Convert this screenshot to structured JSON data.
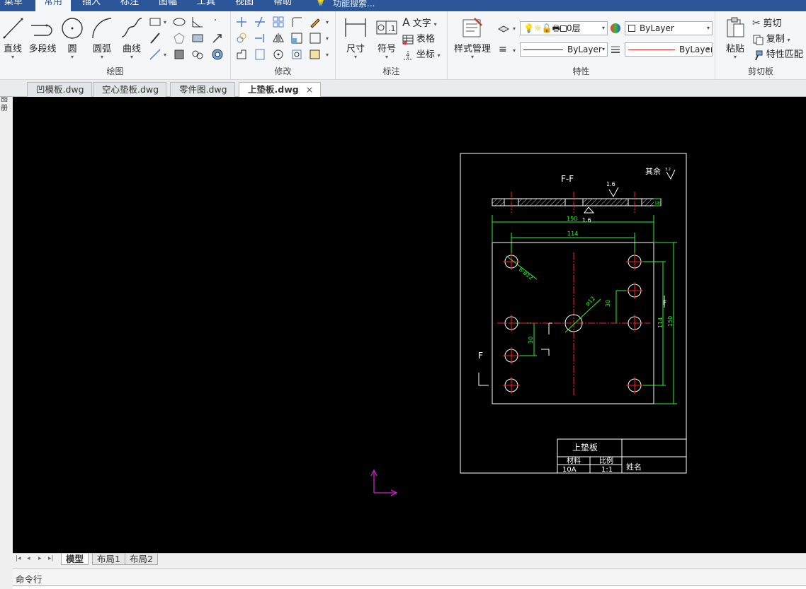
{
  "menu": {
    "tabs": [
      "菜单",
      "常用",
      "插入",
      "标注",
      "图幅",
      "工具",
      "视图",
      "帮助"
    ],
    "active_index": 1,
    "search_placeholder": "功能搜索..."
  },
  "ribbon": {
    "draw": {
      "label": "绘图",
      "line": "直线",
      "polyline": "多段线",
      "circle": "圆",
      "arc": "圆弧",
      "curve": "曲线"
    },
    "modify": {
      "label": "修改"
    },
    "annotate": {
      "label": "标注",
      "dimension": "尺寸",
      "symbol": "符号",
      "text": "文字",
      "table": "表格",
      "coordinate": "坐标"
    },
    "properties": {
      "label": "特性",
      "style_manager": "样式管理",
      "layer_value": "0层",
      "color_value": "ByLayer",
      "linetype_value": "ByLayer",
      "lineweight_value": "ByLayer"
    },
    "clipboard": {
      "label": "剪切板",
      "paste": "粘贴",
      "cut": "剪切",
      "copy": "复制",
      "match_props": "特性匹配"
    }
  },
  "doc_tabs": [
    {
      "label": "凹模板.dwg"
    },
    {
      "label": "空心垫板.dwg"
    },
    {
      "label": "零件图.dwg"
    },
    {
      "label": "上垫板.dwg",
      "active": true
    }
  ],
  "drawing": {
    "section_title": "F-F",
    "roughness_note": "其余",
    "roughness_value_small": "3.2",
    "roughness_top": "1.6",
    "roughness_bottom": "1.6",
    "dims": {
      "width_outer": "150",
      "width_inner": "114",
      "height_outer": "150",
      "height_inner": "114",
      "hole_dia": "6-ø12",
      "center_dia": "ø12",
      "offset_30_a": "30",
      "offset_30_b": "30",
      "thickness": "18"
    },
    "section_mark_left": "F",
    "section_mark_right": "F",
    "title_block": {
      "name": "上垫板",
      "material_label": "材料",
      "scale_label": "比例",
      "material_value": "10A",
      "scale_value": "1:1",
      "name_label": "姓名"
    }
  },
  "layout_tabs": [
    "模型",
    "布局1",
    "布局2"
  ],
  "command_label": "命令行",
  "colors": {
    "ribbon_blue": "#2b579a",
    "dim_green": "#2ef22e",
    "center_red": "#ff2020",
    "ucs_magenta": "#d020d0"
  }
}
